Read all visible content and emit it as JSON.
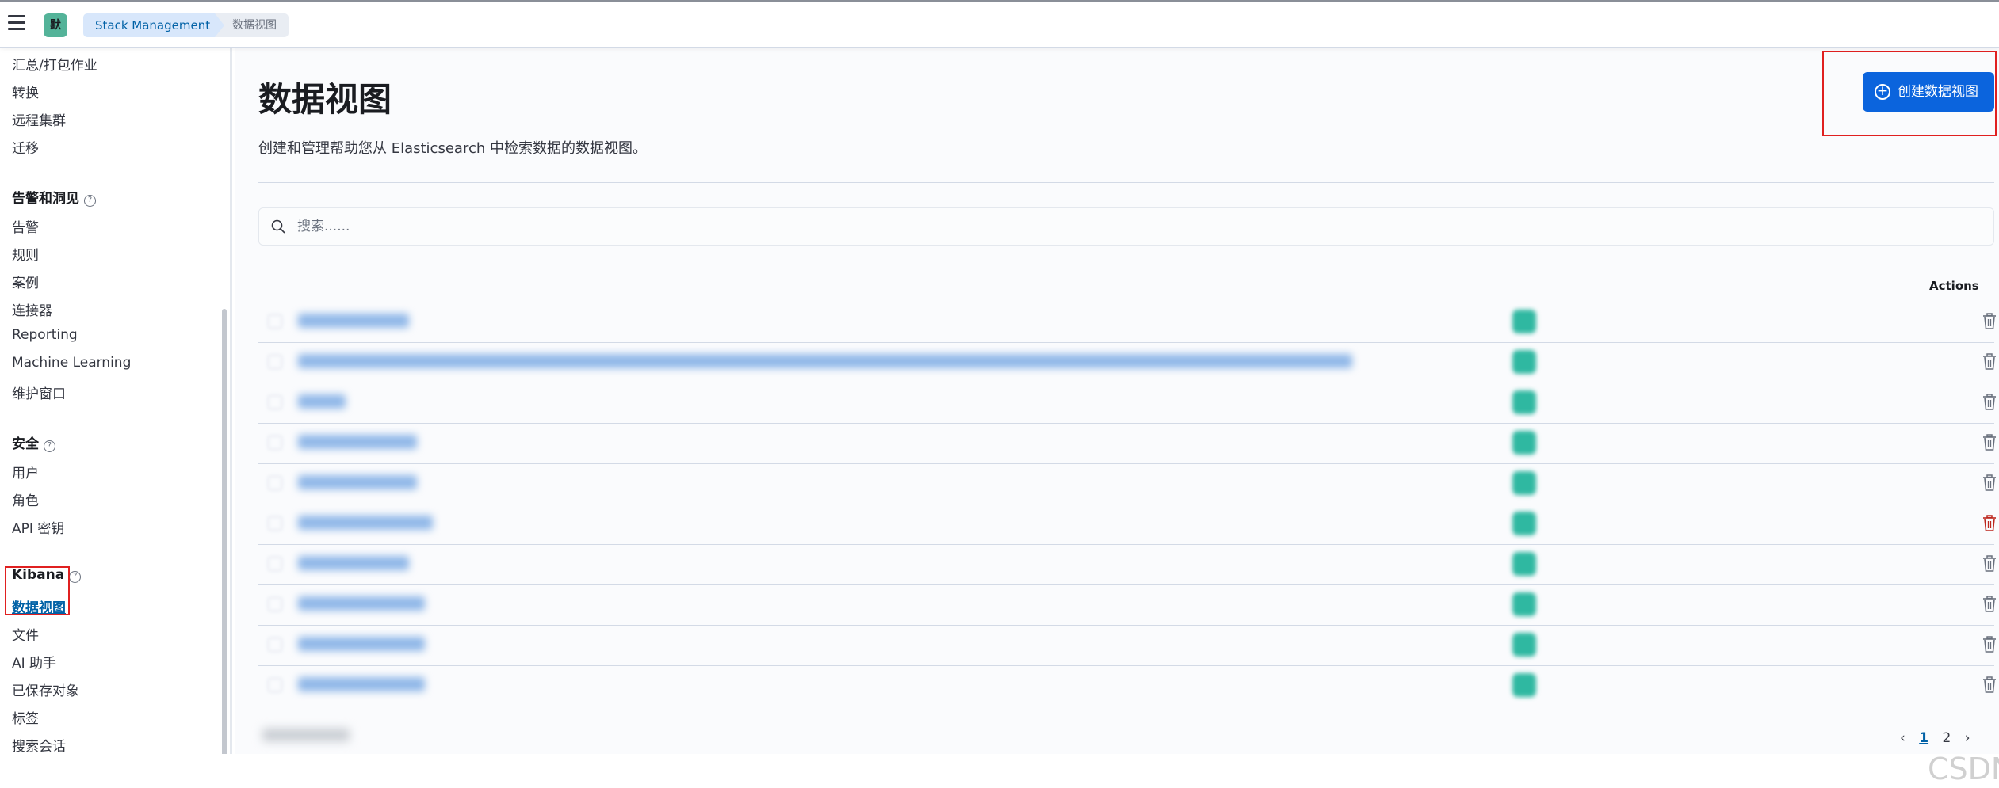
{
  "header": {
    "logo_text": "默",
    "breadcrumbs": [
      "Stack Management",
      "数据视图"
    ]
  },
  "sidebar": {
    "items_top": [
      "汇总/打包作业",
      "转换",
      "远程集群",
      "迁移"
    ],
    "alerts_section": {
      "heading": "告警和洞见",
      "items": [
        "告警",
        "规则",
        "案例",
        "连接器",
        "Reporting",
        "Machine Learning",
        "维护窗口"
      ]
    },
    "security_section": {
      "heading": "安全",
      "items": [
        "用户",
        "角色",
        "API 密钥"
      ]
    },
    "kibana_section": {
      "heading": "Kibana",
      "active_item": "数据视图",
      "items": [
        "文件",
        "AI 助手",
        "已保存对象",
        "标签",
        "搜索会话"
      ]
    }
  },
  "main": {
    "title": "数据视图",
    "description": "创建和管理帮助您从 Elasticsearch 中检索数据的数据视图。",
    "create_button": "创建数据视图",
    "search_placeholder": "搜索......",
    "table": {
      "actions_header": "Actions",
      "row_count": 10
    },
    "pagination": {
      "pages": [
        "1",
        "2"
      ],
      "current_page": "1"
    }
  },
  "watermark": "CSDN @熊の力量",
  "colors": {
    "accent": "#0b64dd",
    "link": "#0061a6",
    "highlight_box": "#e02020",
    "delete_active": "#bd271e"
  }
}
